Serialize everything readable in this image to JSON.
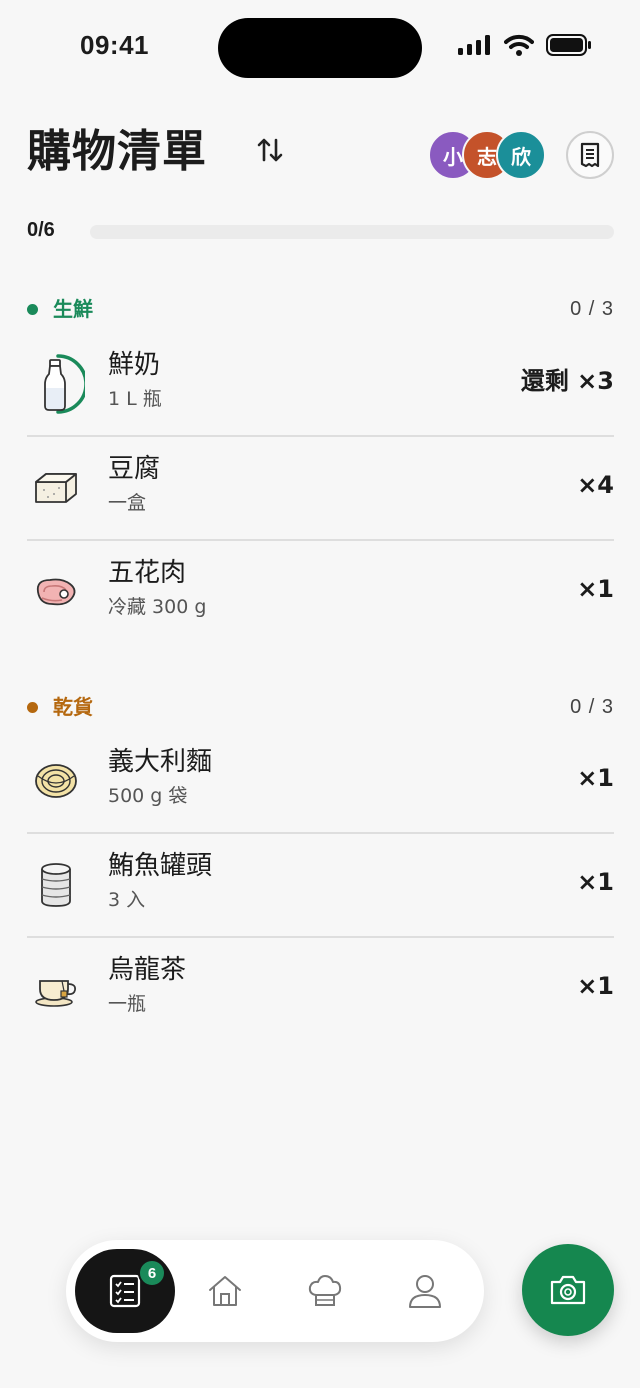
{
  "status_bar": {
    "time": "09:41"
  },
  "header": {
    "title": "購物清單",
    "avatars": [
      "小",
      "志",
      "欣"
    ]
  },
  "progress": {
    "label": "0/6",
    "fraction": 0
  },
  "sections": [
    {
      "name": "生鮮",
      "count": "0 / 3",
      "color": "#1a8a5a",
      "items": [
        {
          "name": "鮮奶",
          "sub": "1 L 瓶",
          "qty": "還剩 ×3",
          "icon": "milk-bottle-icon"
        },
        {
          "name": "豆腐",
          "sub": "一盒",
          "qty": "×4",
          "icon": "tofu-icon"
        },
        {
          "name": "五花肉",
          "sub": "冷藏 300 g",
          "qty": "×1",
          "icon": "meat-icon"
        }
      ]
    },
    {
      "name": "乾貨",
      "count": "0 / 3",
      "color": "#b5680f",
      "items": [
        {
          "name": "義大利麵",
          "sub": "500 g 袋",
          "qty": "×1",
          "icon": "pasta-icon"
        },
        {
          "name": "鮪魚罐頭",
          "sub": "3 入",
          "qty": "×1",
          "icon": "tin-can-icon"
        },
        {
          "name": "烏龍茶",
          "sub": "一瓶",
          "qty": "×1",
          "icon": "teacup-icon"
        }
      ]
    }
  ],
  "bottom_nav": {
    "badge": "6",
    "items": [
      "checklist-icon",
      "home-icon",
      "chef-hat-icon",
      "user-icon"
    ]
  },
  "fab": {
    "icon": "camera-icon"
  },
  "colors": {
    "accent": "#1a8a5a",
    "dry_goods": "#b5680f"
  }
}
